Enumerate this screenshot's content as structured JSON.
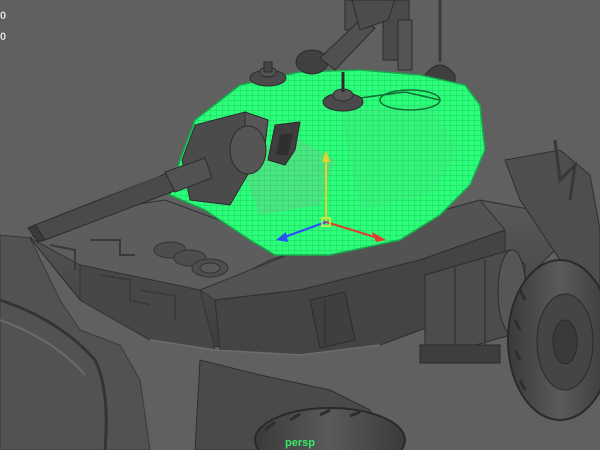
{
  "viewport": {
    "camera_label": "persp",
    "hud_values": [
      "0",
      "0"
    ],
    "selection_color": "#2bff7a",
    "background_color": "#606060",
    "mesh_color": "#4a4a4a"
  },
  "scene": {
    "model": "armored-vehicle-mesh",
    "selected_part": "turret"
  },
  "icons": {
    "gizmo": "move-manipulator-icon"
  }
}
